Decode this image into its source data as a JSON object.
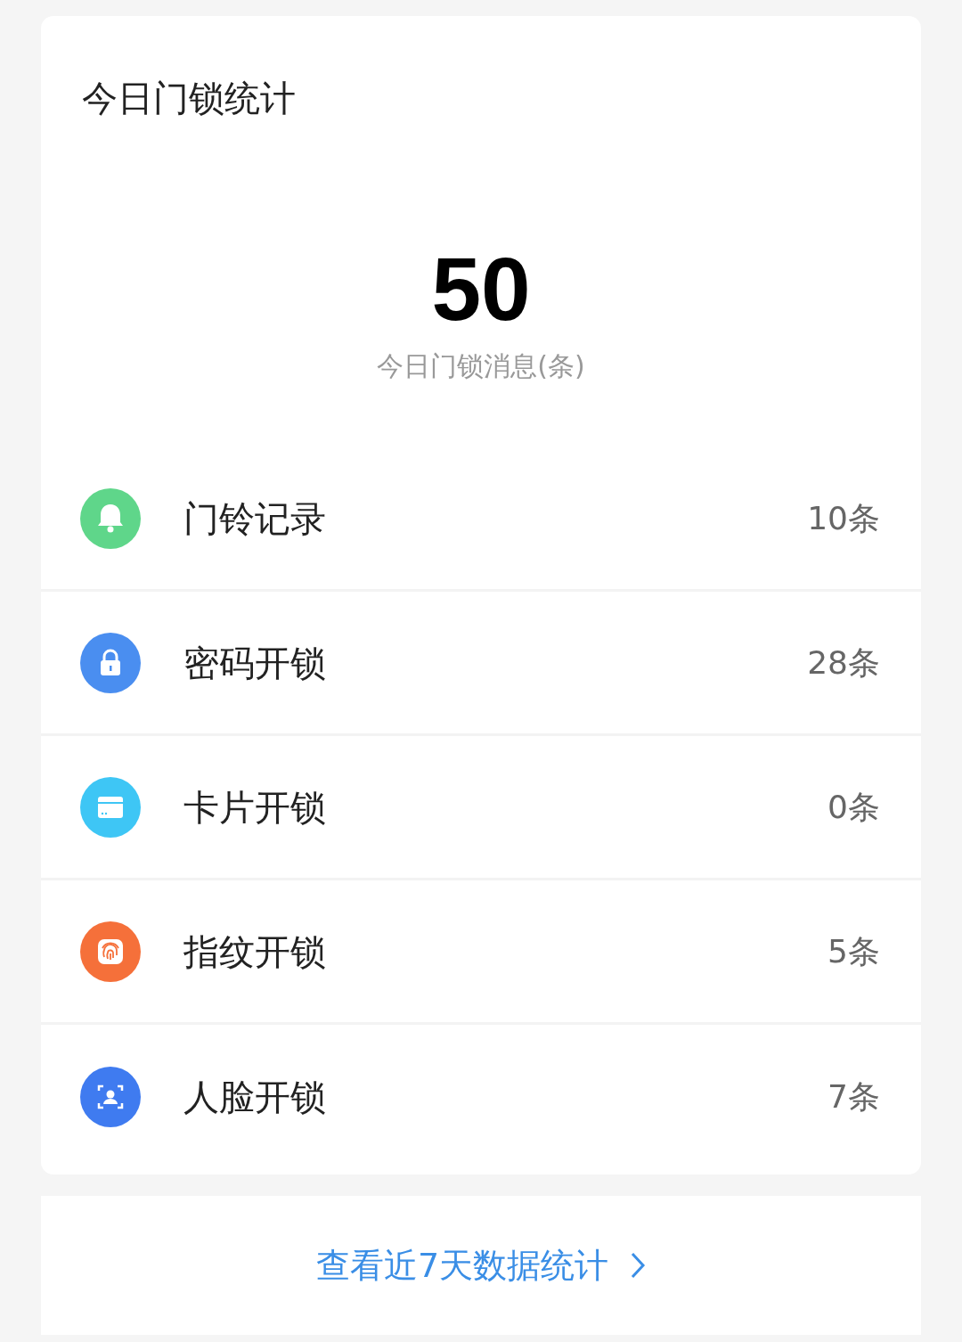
{
  "card": {
    "title": "今日门锁统计",
    "total": "50",
    "total_label": "今日门锁消息(条)"
  },
  "items": [
    {
      "kind": "bell",
      "label": "门铃记录",
      "count": "10条",
      "color": "#5fd68a"
    },
    {
      "kind": "lock",
      "label": "密码开锁",
      "count": "28条",
      "color": "#4a8ef0"
    },
    {
      "kind": "card",
      "label": "卡片开锁",
      "count": "0条",
      "color": "#3ec6f5"
    },
    {
      "kind": "fingerprint",
      "label": "指纹开锁",
      "count": "5条",
      "color": "#f5703a"
    },
    {
      "kind": "face",
      "label": "人脸开锁",
      "count": "7条",
      "color": "#3f7bf0"
    }
  ],
  "link": {
    "label": "查看近7天数据统计"
  }
}
